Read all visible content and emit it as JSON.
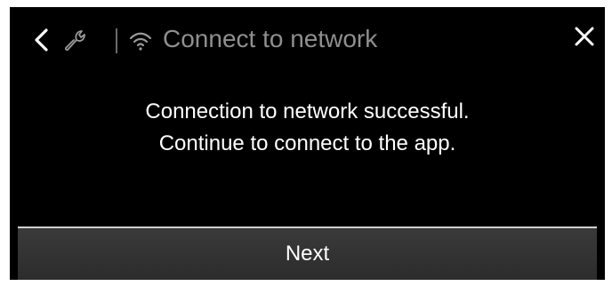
{
  "header": {
    "title": "Connect to network",
    "icons": {
      "back": "chevron-left-icon",
      "settings": "wrench-icon",
      "network": "wifi-icon",
      "close": "close-icon"
    }
  },
  "message": {
    "line1": "Connection to network successful.",
    "line2": "Continue to connect to the app."
  },
  "footer": {
    "next_label": "Next"
  },
  "colors": {
    "background": "#000000",
    "title": "#8f8f8f",
    "text": "#ffffff",
    "button": "#333333",
    "button_border": "#d0d0d0"
  }
}
